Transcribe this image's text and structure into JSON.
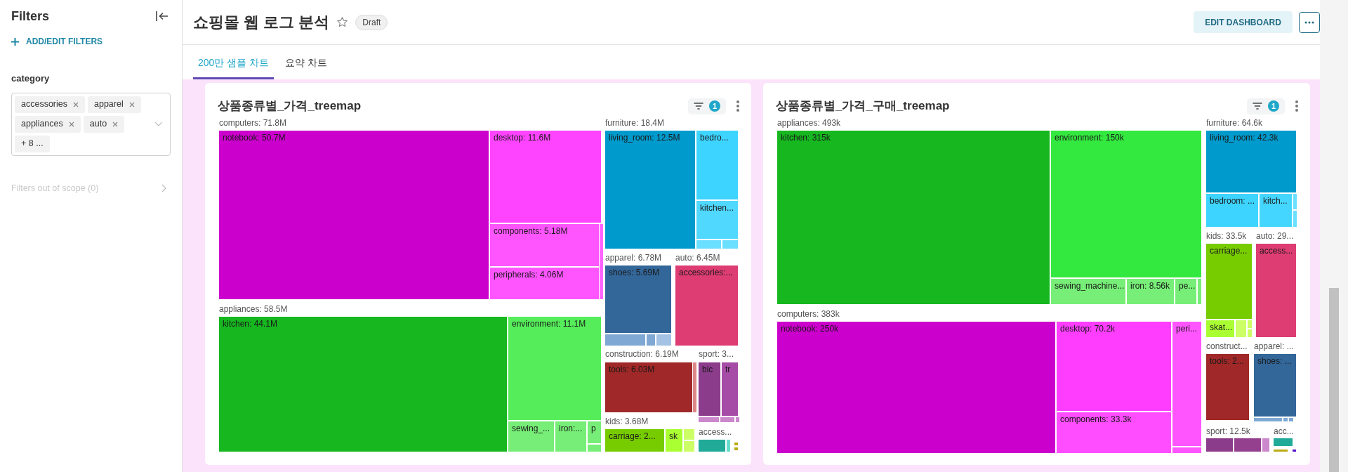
{
  "sidebar": {
    "title": "Filters",
    "add_filters": "ADD/EDIT FILTERS",
    "filter": {
      "label": "category",
      "chips": [
        "accessories",
        "apparel",
        "appliances",
        "auto"
      ],
      "more": "+ 8 ..."
    },
    "out_of_scope": "Filters out of scope (0)"
  },
  "header": {
    "title": "쇼핑몰 웹 로그 분석",
    "status": "Draft",
    "edit_button": "EDIT DASHBOARD"
  },
  "tabs": [
    {
      "label": "200만 샘플 차트",
      "selected": true
    },
    {
      "label": "요약 차트",
      "selected": false
    }
  ],
  "charts": [
    {
      "title": "상품종류별_가격_treemap",
      "filter_count": "1",
      "groups": [
        {
          "label": "computers: 71.8M",
          "tiles": [
            {
              "label": "notebook: 50.7M",
              "color": "#cc00cc"
            },
            {
              "label": "desktop: 11.6M",
              "color": "#ff44ff"
            },
            {
              "label": "components: 5.18M",
              "color": "#ff55ff"
            },
            {
              "label": "peripherals: 4.06M",
              "color": "#ff55ff"
            },
            {
              "color": "#ff66ff"
            }
          ]
        },
        {
          "label": "appliances: 58.5M",
          "tiles": [
            {
              "label": "kitchen: 44.1M",
              "color": "#16b71f"
            },
            {
              "label": "environment: 11.1M",
              "color": "#55ee5a"
            },
            {
              "label": "sewing_...",
              "color": "#77ee77"
            },
            {
              "label": "iron:...",
              "color": "#77ee77"
            },
            {
              "label": "p",
              "color": "#77ee77"
            },
            {
              "color": "#77ee77"
            }
          ]
        },
        {
          "label": "furniture: 18.4M",
          "tiles": [
            {
              "label": "living_room: 12.5M",
              "color": "#009acc"
            },
            {
              "label": "bedro...",
              "color": "#3dd4ff"
            },
            {
              "label": "kitchen...",
              "color": "#50d8ff"
            },
            {
              "color": "#6adfff"
            },
            {
              "color": "#6adfff"
            }
          ]
        },
        {
          "label": "apparel: 6.78M",
          "tiles": [
            {
              "label": "shoes: 5.69M",
              "color": "#336699"
            },
            {
              "color": "#7fa8d4"
            },
            {
              "color": "#7fa8d4"
            },
            {
              "color": "#a4c2e4"
            }
          ]
        },
        {
          "label": "auto: 6.45M",
          "tiles": [
            {
              "label": "accessories:...",
              "color": "#dd3d72"
            }
          ]
        },
        {
          "label": "construction: 6.19M",
          "tiles": [
            {
              "label": "tools: 6.03M",
              "color": "#a02828"
            },
            {
              "color": "#dd8888"
            }
          ]
        },
        {
          "label": "sport: 3...",
          "tiles": [
            {
              "label": "bic",
              "color": "#8b3c8b"
            },
            {
              "label": "tr",
              "color": "#a64ca6"
            },
            {
              "color": "#cc88cc"
            },
            {
              "color": "#cc88cc"
            },
            {
              "color": "#cc88cc"
            }
          ]
        },
        {
          "label": "kids: 3.68M",
          "tiles": [
            {
              "label": "carriage: 2...",
              "color": "#77cc00"
            },
            {
              "label": "sk",
              "color": "#aaff33"
            },
            {
              "color": "#ccff66"
            },
            {
              "color": "#ccff66"
            }
          ]
        },
        {
          "label": "access...",
          "tiles": [
            {
              "color": "#22aa99"
            },
            {
              "color": "#66ddcc"
            },
            {
              "color": "#bbaa11"
            },
            {
              "color": "#bbaa11"
            }
          ]
        }
      ]
    },
    {
      "title": "상품종류별_가격_구매_treemap",
      "filter_count": "1",
      "groups": [
        {
          "label": "appliances: 493k",
          "tiles": [
            {
              "label": "kitchen: 315k",
              "color": "#16b71f"
            },
            {
              "label": "environment: 150k",
              "color": "#33e83e"
            },
            {
              "label": "sewing_machine...",
              "color": "#77ee77"
            },
            {
              "label": "iron: 8.56k",
              "color": "#77ee77"
            },
            {
              "label": "pe...",
              "color": "#77ee77"
            },
            {
              "color": "#77ee77"
            }
          ]
        },
        {
          "label": "computers: 383k",
          "tiles": [
            {
              "label": "notebook: 250k",
              "color": "#cc00cc"
            },
            {
              "label": "desktop: 70.2k",
              "color": "#ff3dff"
            },
            {
              "label": "components: 33.3k",
              "color": "#ff4dff"
            },
            {
              "label": "peri...",
              "color": "#ff55ff"
            },
            {
              "color": "#ff55ff"
            }
          ]
        },
        {
          "label": "furniture: 64.6k",
          "tiles": [
            {
              "label": "living_room: 42.3k",
              "color": "#009acc"
            },
            {
              "label": "bedroom: ...",
              "color": "#3dd4ff"
            },
            {
              "label": "kitch...",
              "color": "#45d6ff"
            },
            {
              "color": "#6adfff"
            },
            {
              "color": "#6adfff"
            }
          ]
        },
        {
          "label": "kids: 33.5k",
          "tiles": [
            {
              "label": "carriage...",
              "color": "#77cc00"
            },
            {
              "label": "skat...",
              "color": "#aaff33"
            },
            {
              "color": "#ccff66"
            },
            {
              "color": "#ccff66"
            },
            {
              "color": "#ccff66"
            }
          ]
        },
        {
          "label": "auto: 29...",
          "tiles": [
            {
              "label": "access...",
              "color": "#dd3d72"
            }
          ]
        },
        {
          "label": "construct...",
          "tiles": [
            {
              "label": "tools: 2...",
              "color": "#a02828"
            }
          ]
        },
        {
          "label": "apparel: ...",
          "tiles": [
            {
              "label": "shoes: ...",
              "color": "#336699"
            },
            {
              "color": "#7fa8d4"
            },
            {
              "color": "#7fa8d4"
            },
            {
              "color": "#7fa8d4"
            }
          ]
        },
        {
          "label": "sport: 12.5k",
          "tiles": [
            {
              "color": "#8b3c8b"
            },
            {
              "color": "#94408f"
            },
            {
              "color": "#cc88cc"
            }
          ]
        },
        {
          "label": "acc...",
          "tiles": [
            {
              "color": "#22aa99"
            },
            {
              "color": "#bbaa11"
            },
            {
              "color": "#5511cc"
            }
          ]
        }
      ]
    }
  ]
}
